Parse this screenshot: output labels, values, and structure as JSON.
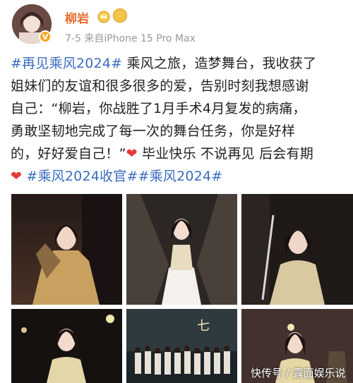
{
  "user": {
    "name": "柳岩",
    "verified_mark": "V",
    "meta": "7-5  来自iPhone 15 Pro Max"
  },
  "post": {
    "line1_tag": "#再见乘风2024#",
    "line1_text": " 乘风之旅，造梦舞台，我收获了",
    "line2": "姐妹们的友谊和很多很多的爱，告别时刻我想感谢",
    "line3": "自己：“柳岩，你战胜了1月手术4月复发的病痛，",
    "line4": "勇敢坚韧地完成了每一次的舞台任务，你是好样",
    "line5_text": "的，好好爱自己！”",
    "line5_after": " 毕业快乐 不说再见 后会有期",
    "line6_tags": " #乘风2024收官##乘风2024#",
    "heart": "❤"
  },
  "photos": [
    {
      "name": "photo-1",
      "icon": "performance-photo"
    },
    {
      "name": "photo-2",
      "icon": "performance-photo"
    },
    {
      "name": "photo-3",
      "icon": "performance-photo"
    },
    {
      "name": "photo-4",
      "icon": "performance-photo"
    },
    {
      "name": "photo-5",
      "icon": "group-photo"
    },
    {
      "name": "photo-6",
      "icon": "performance-photo"
    }
  ],
  "watermark": "快传号 / 露面娱乐说",
  "colors": {
    "username": "#e86a2c",
    "tag": "#3a6cbf",
    "heart": "#e5393a",
    "meta": "#999999"
  }
}
